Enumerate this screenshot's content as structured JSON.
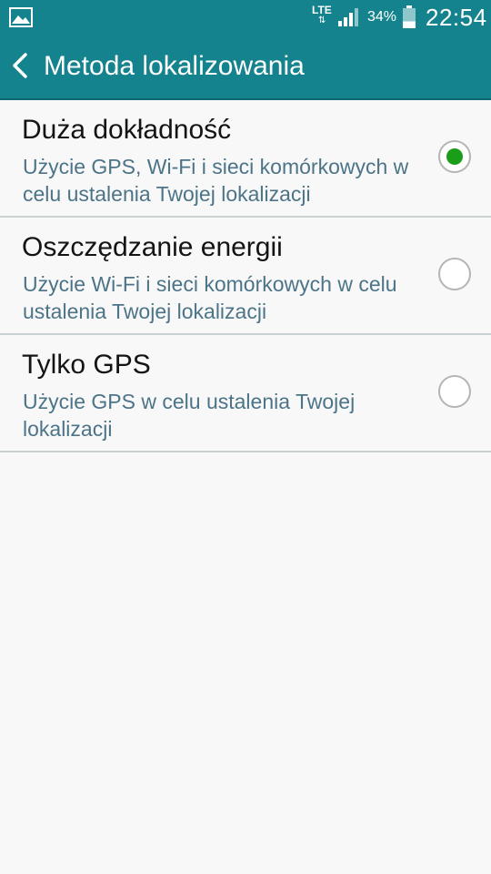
{
  "status_bar": {
    "network": "LTE",
    "network_arrows": "⇅",
    "battery_percent": "34%",
    "battery_level": 0.34,
    "time": "22:54",
    "left_icon": "gallery-icon"
  },
  "app_bar": {
    "back_icon": "chevron-left-icon",
    "title": "Metoda lokalizowania"
  },
  "options": [
    {
      "title": "Duża dokładność",
      "description": "Użycie GPS, Wi-Fi i sieci komórkowych w celu ustalenia Twojej lokalizacji",
      "selected": true
    },
    {
      "title": "Oszczędzanie energii",
      "description": "Użycie Wi-Fi i sieci komórkowych w celu ustalenia Twojej lokalizacji",
      "selected": false
    },
    {
      "title": "Tylko GPS",
      "description": "Użycie GPS w celu ustalenia Twojej lokalizacji",
      "selected": false
    }
  ],
  "colors": {
    "accent": "#15838e",
    "radio_selected": "#1a9e1a",
    "description_text": "#4c7488"
  }
}
